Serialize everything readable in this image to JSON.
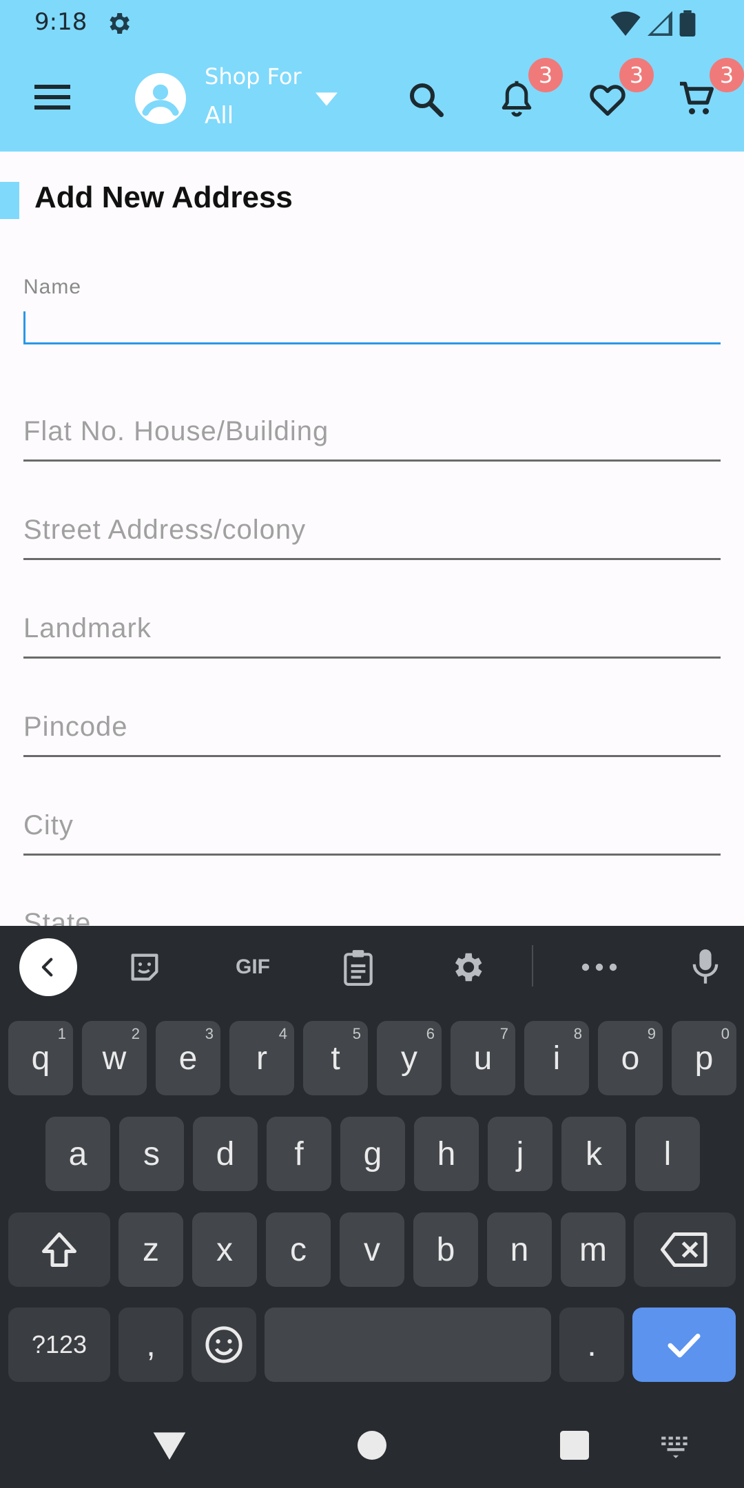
{
  "status_bar": {
    "time": "9:18"
  },
  "app_bar": {
    "shop_for_label": "Shop For",
    "shop_for_value": "All",
    "notifications_count": "3",
    "wishlist_count": "3",
    "cart_count": "3"
  },
  "page": {
    "title": "Add New Address"
  },
  "form": {
    "name_label": "Name",
    "flat_label": "Flat No. House/Building",
    "street_label": "Street Address/colony",
    "landmark_label": "Landmark",
    "pincode_label": "Pincode",
    "city_label": "City",
    "state_label": "State"
  },
  "keyboard": {
    "gif_label": "GIF",
    "row1": [
      {
        "k": "q",
        "h": "1"
      },
      {
        "k": "w",
        "h": "2"
      },
      {
        "k": "e",
        "h": "3"
      },
      {
        "k": "r",
        "h": "4"
      },
      {
        "k": "t",
        "h": "5"
      },
      {
        "k": "y",
        "h": "6"
      },
      {
        "k": "u",
        "h": "7"
      },
      {
        "k": "i",
        "h": "8"
      },
      {
        "k": "o",
        "h": "9"
      },
      {
        "k": "p",
        "h": "0"
      }
    ],
    "row2": [
      "a",
      "s",
      "d",
      "f",
      "g",
      "h",
      "j",
      "k",
      "l"
    ],
    "row3": [
      "z",
      "x",
      "c",
      "v",
      "b",
      "n",
      "m"
    ],
    "symbols_label": "?123",
    "comma_label": ",",
    "period_label": "."
  },
  "colors": {
    "header": "#7fd9fb",
    "accent": "#2a97e8",
    "badge": "#f07a7a",
    "enter": "#5b93ee"
  }
}
